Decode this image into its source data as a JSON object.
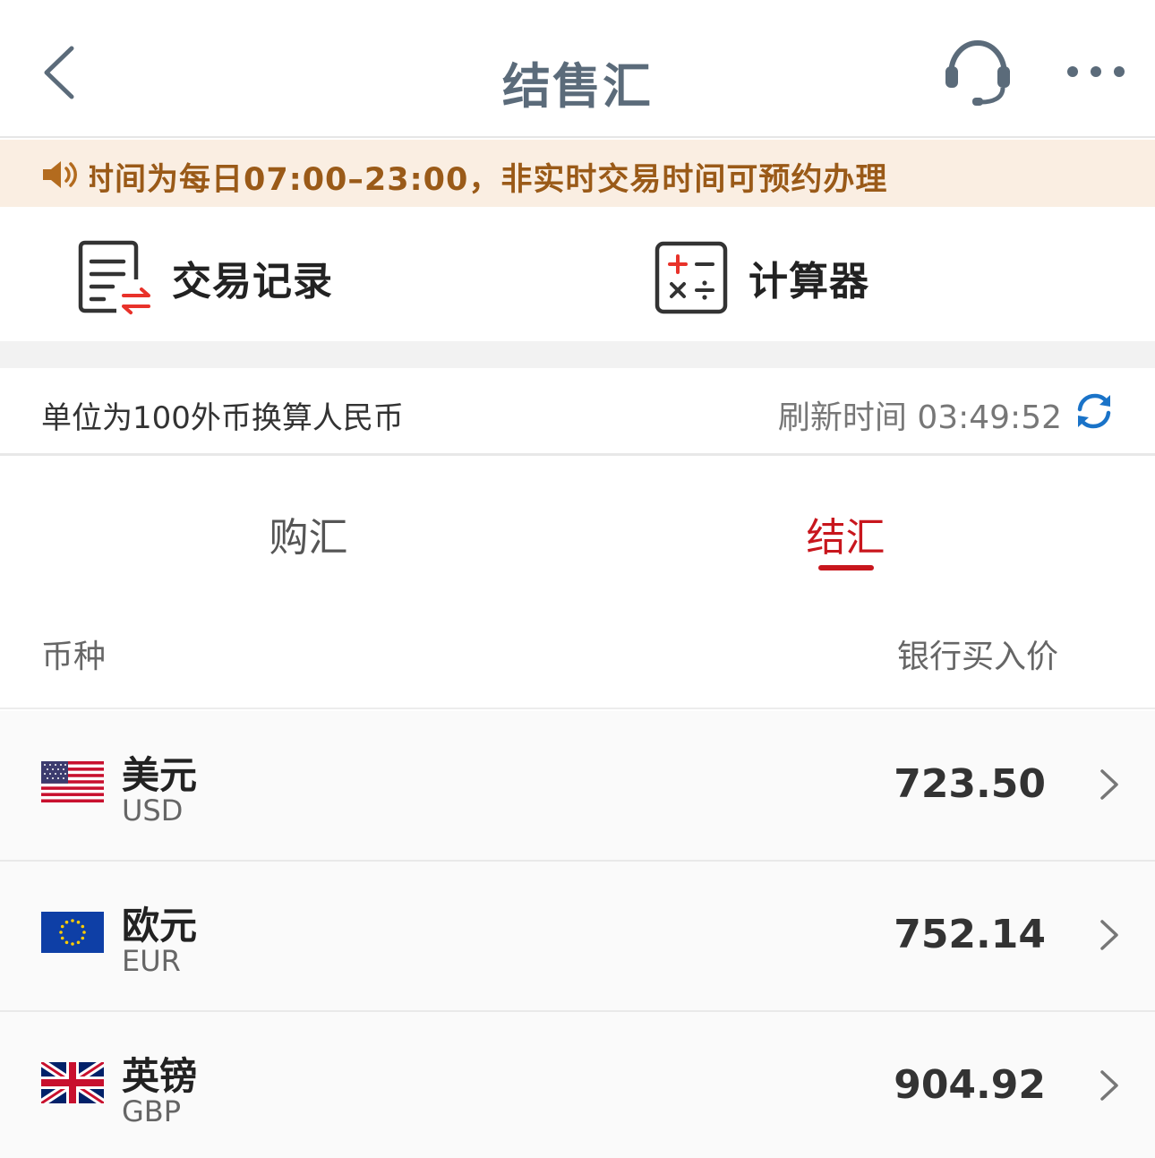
{
  "nav": {
    "title": "结售汇"
  },
  "notice": {
    "text": "时间为每日07:00–23:00，非实时交易时间可预约办理"
  },
  "quick": {
    "records_label": "交易记录",
    "calculator_label": "计算器"
  },
  "info": {
    "unit_text": "单位为100外币换算人民币",
    "refresh_label": "刷新时间",
    "refresh_time": "03:49:52"
  },
  "tabs": {
    "buy_label": "购汇",
    "sell_label": "结汇",
    "active": "sell"
  },
  "table": {
    "col_currency": "币种",
    "col_price": "银行买入价",
    "rows": [
      {
        "name": "美元",
        "code": "USD",
        "price": "723.50",
        "flag_icon": "us-flag-icon"
      },
      {
        "name": "欧元",
        "code": "EUR",
        "price": "752.14",
        "flag_icon": "eu-flag-icon"
      },
      {
        "name": "英镑",
        "code": "GBP",
        "price": "904.92",
        "flag_icon": "uk-flag-icon"
      }
    ]
  },
  "colors": {
    "accent": "#c8161d",
    "title": "#5b6b7a",
    "notice_bg": "#faeee2",
    "notice_text": "#9a5a18",
    "refresh_icon": "#1a73c8"
  }
}
